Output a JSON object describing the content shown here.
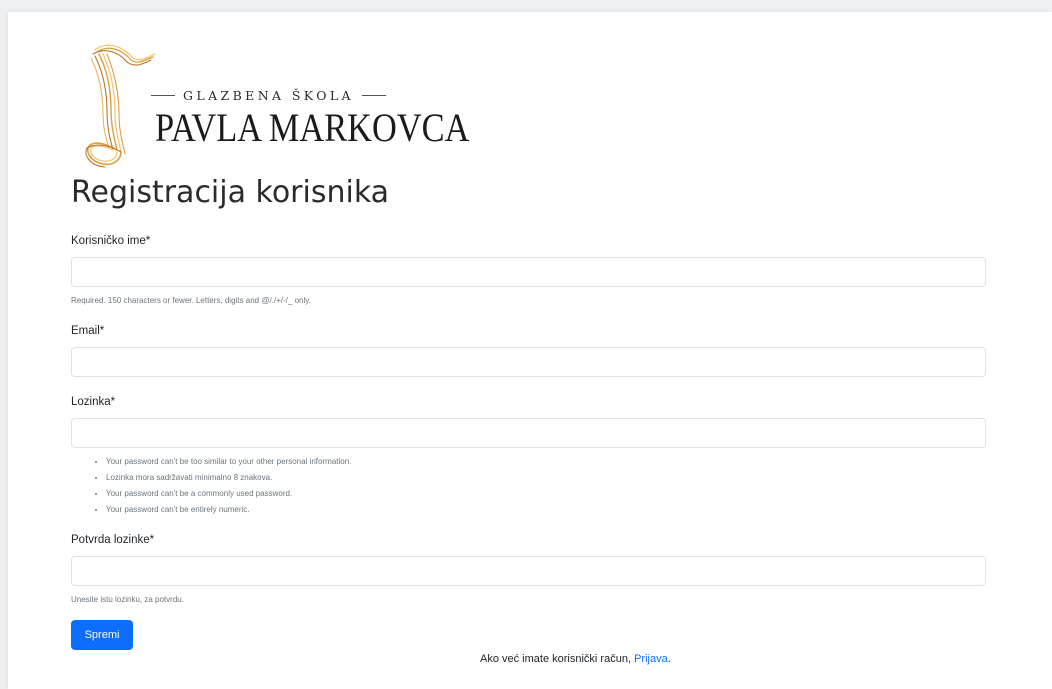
{
  "logo": {
    "top_text": "GLAZBENA ŠKOLA",
    "main_text": "PAVLA MARKOVCA",
    "colors": {
      "gold": "#d9a13f",
      "gold_light": "#efc77c",
      "gold_dark": "#b8762b"
    }
  },
  "page": {
    "title": "Registracija korisnika"
  },
  "form": {
    "username": {
      "label": "Korisničko ime*",
      "value": "",
      "help": "Required. 150 characters or fewer. Letters, digits and @/./+/-/_ only."
    },
    "email": {
      "label": "Email*",
      "value": ""
    },
    "password": {
      "label": "Lozinka*",
      "value": "",
      "help_items": [
        "Your password can't be too similar to your other personal information.",
        "Lozinka mora sadržavati minimalno 8 znakova.",
        "Your password can't be a commonly used password.",
        "Your password can't be entirely numeric."
      ]
    },
    "password_confirm": {
      "label": "Potvrda lozinke*",
      "value": "",
      "help": "Unesite istu lozinku, za potvrdu."
    },
    "submit_label": "Spremi"
  },
  "login": {
    "text": "Ako već imate korisnički račun, ",
    "link": "Prijava",
    "suffix": "."
  },
  "colors": {
    "primary": "#0d6efd",
    "muted": "#6c757d",
    "input_border": "#dee2e6"
  }
}
